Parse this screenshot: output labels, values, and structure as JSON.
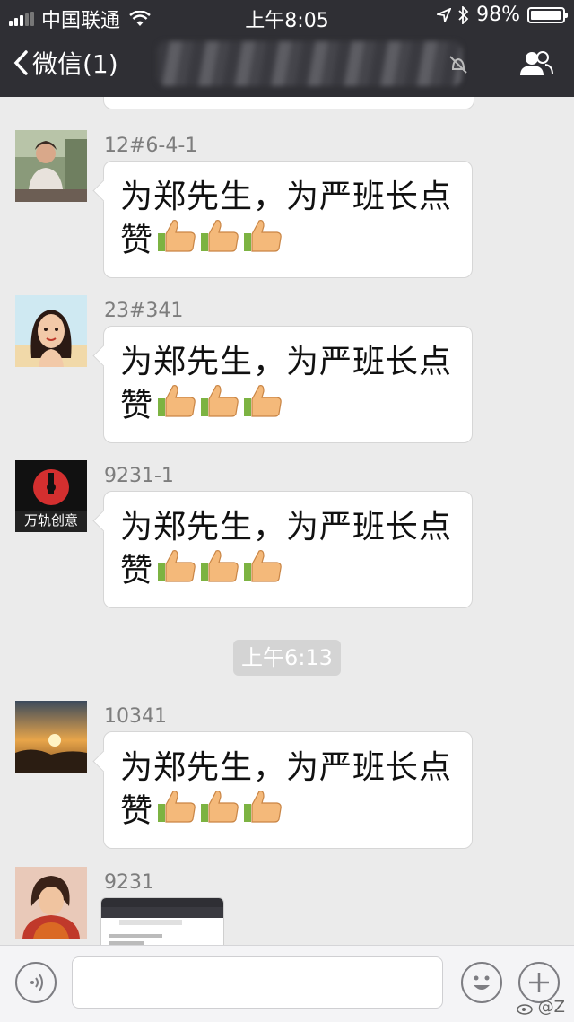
{
  "status_bar": {
    "carrier": "中国联通",
    "time": "上午8:05",
    "battery": "98%",
    "battery_level": 0.98
  },
  "nav": {
    "back_label": "微信(1)",
    "icons": [
      "chevron-left-icon",
      "mute-icon",
      "contacts-icon"
    ]
  },
  "messages": [
    {
      "sender": "12#6-4-1",
      "text": "为郑先生，为严班长点赞"
    },
    {
      "sender": "23#341",
      "text": "为郑先生，为严班长点赞"
    },
    {
      "sender": "9231-1",
      "text": "为郑先生，为严班长点赞",
      "avatar_text": "万轨创意"
    },
    {
      "sender": "10341",
      "text": "为郑先生，为严班长点赞"
    },
    {
      "sender": "9231",
      "attachment": "screenshot-image"
    }
  ],
  "timestamp_pill": "上午6:13",
  "input_bar": {
    "icons": [
      "voice-icon",
      "emoji-icon",
      "plus-icon"
    ]
  },
  "watermark": "@Z"
}
